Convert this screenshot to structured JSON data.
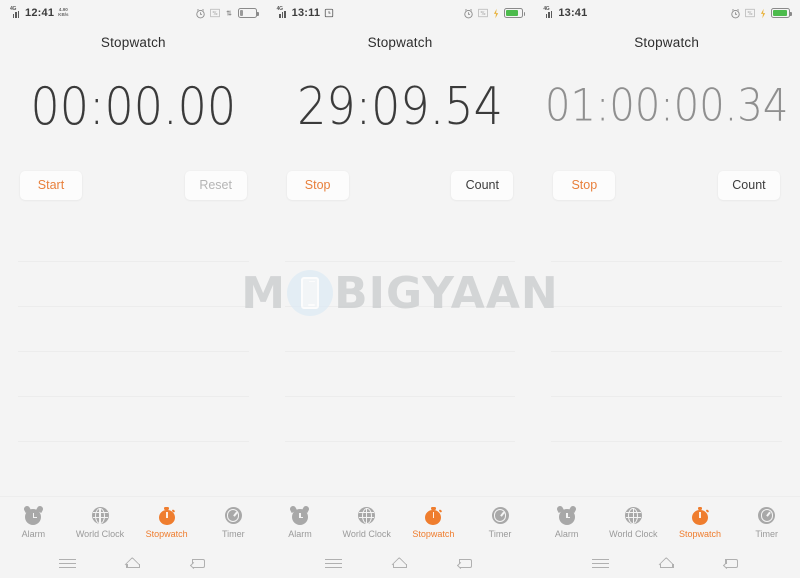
{
  "watermark": {
    "text_left": "M",
    "text_right": "BIGYAAN",
    "icon": "phone-in-circle-icon"
  },
  "panels": [
    {
      "id": "panel-start",
      "statusbar": {
        "time": "12:41",
        "network_label": "4G",
        "speed_value": "4.90",
        "speed_unit": "KB/s",
        "icons": [
          "signal-icon",
          "alarm-icon",
          "wifi-icon",
          "network-icon",
          "battery-icon"
        ],
        "battery_state": "low"
      },
      "header": {
        "title": "Stopwatch"
      },
      "display": {
        "time": "00:00.00",
        "state": "reset"
      },
      "buttons": {
        "primary": {
          "label": "Start",
          "style": "orange"
        },
        "secondary": {
          "label": "Reset",
          "style": "disabled"
        }
      },
      "tabs": [
        {
          "label": "Alarm",
          "icon": "alarm-icon",
          "active": false
        },
        {
          "label": "World Clock",
          "icon": "globe-icon",
          "active": false
        },
        {
          "label": "Stopwatch",
          "icon": "stopwatch-icon",
          "active": true
        },
        {
          "label": "Timer",
          "icon": "timer-icon",
          "active": false
        }
      ]
    },
    {
      "id": "panel-running",
      "statusbar": {
        "time": "13:11",
        "network_label": "4G",
        "speed_value": "",
        "speed_unit": "",
        "icons": [
          "signal-icon",
          "alarm-clock-icon",
          "alarm-icon",
          "wifi-icon",
          "bolt-icon",
          "battery-icon"
        ],
        "battery_state": "charging"
      },
      "header": {
        "title": "Stopwatch"
      },
      "display": {
        "time": "29:09.54",
        "state": "running"
      },
      "buttons": {
        "primary": {
          "label": "Stop",
          "style": "orange"
        },
        "secondary": {
          "label": "Count",
          "style": "dark"
        }
      },
      "tabs": [
        {
          "label": "Alarm",
          "icon": "alarm-icon",
          "active": false
        },
        {
          "label": "World Clock",
          "icon": "globe-icon",
          "active": false
        },
        {
          "label": "Stopwatch",
          "icon": "stopwatch-icon",
          "active": true
        },
        {
          "label": "Timer",
          "icon": "timer-icon",
          "active": false
        }
      ]
    },
    {
      "id": "panel-hour",
      "statusbar": {
        "time": "13:41",
        "network_label": "4G",
        "speed_value": "",
        "speed_unit": "",
        "icons": [
          "signal-icon",
          "alarm-icon",
          "wifi-icon",
          "bolt-icon",
          "battery-icon"
        ],
        "battery_state": "charging-full"
      },
      "header": {
        "title": "Stopwatch"
      },
      "display": {
        "time": "01:00:00.34",
        "state": "running-dim"
      },
      "buttons": {
        "primary": {
          "label": "Stop",
          "style": "orange"
        },
        "secondary": {
          "label": "Count",
          "style": "dark"
        }
      },
      "tabs": [
        {
          "label": "Alarm",
          "icon": "alarm-icon",
          "active": false
        },
        {
          "label": "World Clock",
          "icon": "globe-icon",
          "active": false
        },
        {
          "label": "Stopwatch",
          "icon": "stopwatch-icon",
          "active": true
        },
        {
          "label": "Timer",
          "icon": "timer-icon",
          "active": false
        }
      ]
    }
  ],
  "navbar": {
    "items": [
      {
        "name": "recents",
        "icon": "menu-icon"
      },
      {
        "name": "home",
        "icon": "home-icon"
      },
      {
        "name": "back",
        "icon": "back-icon"
      }
    ]
  },
  "colors": {
    "accent": "#ef7d2e",
    "background": "#f4f4f4",
    "text": "#3a3a3a",
    "muted": "#9a9a9a",
    "battery_green": "#4cbb4c"
  }
}
